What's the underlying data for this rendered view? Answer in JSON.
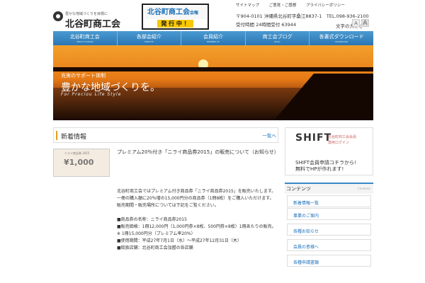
{
  "header": {
    "tagline": "豊かな地域づくりを目標に",
    "org_name": "北谷町商工会",
    "banner_title": "北谷町商工会",
    "banner_title_small": "会報",
    "banner_status": "発 行 中 ！",
    "utility": {
      "sitemap": "サイトマップ",
      "contact": "ご意見・ご感想",
      "privacy": "プライバシーポリシー"
    },
    "contact_line": "〒904-0101 沖縄県北谷町字桑江8837-1　TEL.098-936-2100",
    "hours_line": "受付時間 24時間受付 63944",
    "text_size_label": "文字の大きさ",
    "text_size_small": "A",
    "text_size_large": "A"
  },
  "nav": [
    {
      "label": "北谷町商工会",
      "sub": "ABOUT CHATAN"
    },
    {
      "label": "各部会紹介",
      "sub": "SERVICE"
    },
    {
      "label": "会員紹介",
      "sub": "MEMBER OF"
    },
    {
      "label": "商工会ブログ",
      "sub": "BLOG"
    },
    {
      "label": "各書式ダウンロード",
      "sub": "DOWNLOAD"
    }
  ],
  "hero": {
    "line1": "充実のサポート体制",
    "line2": "豊かな地域づくりを。",
    "line3": "For Preciou Life Style"
  },
  "news": {
    "title": "新着情報",
    "more": "一覧へ",
    "voucher_small": "ニライ商品券 2015",
    "voucher_value": "¥1,000",
    "article_title": "プレミアム20％付き「ニライ商品券2015」の販売について（お知らせ）",
    "body": [
      "北谷町商工会ではプレミアム付き商品券「ニライ商品券2015」を販売いたします。",
      "一冊の購入額に20％増の15,000円分の商品券（1冊8枚）をご購入いただけます。",
      "販売期間・販売場所については下記をご覧ください。",
      "",
      "■商品券の名称：ニライ商品券2015",
      "■販売価格：1冊12,000円（1,000円券×8枚、500円券×8枚）1冊あたりの販売。",
      "※ 1冊15,000円分（プレミアム率20%）",
      "■使用期間：平成27年7月1日（水）〜平成27年12月31日（木）",
      "■取扱店舗：北谷町商工会加盟の各店舗"
    ]
  },
  "sidebar": {
    "shift_logo": "SHIFT",
    "shift_sub": "北谷町商工会会員",
    "shift_login": "専用ログイン",
    "shift_ad_1": "SHIFT会員申請コチラから!",
    "shift_ad_2": "無料でHPが作れます!",
    "contents_title": "コンテンツ",
    "contents_en": "Contents",
    "items": [
      "新着情報一覧",
      "事業のご案内",
      "各種お知らせ",
      "会員の皆様へ",
      "各種申請書類"
    ]
  }
}
